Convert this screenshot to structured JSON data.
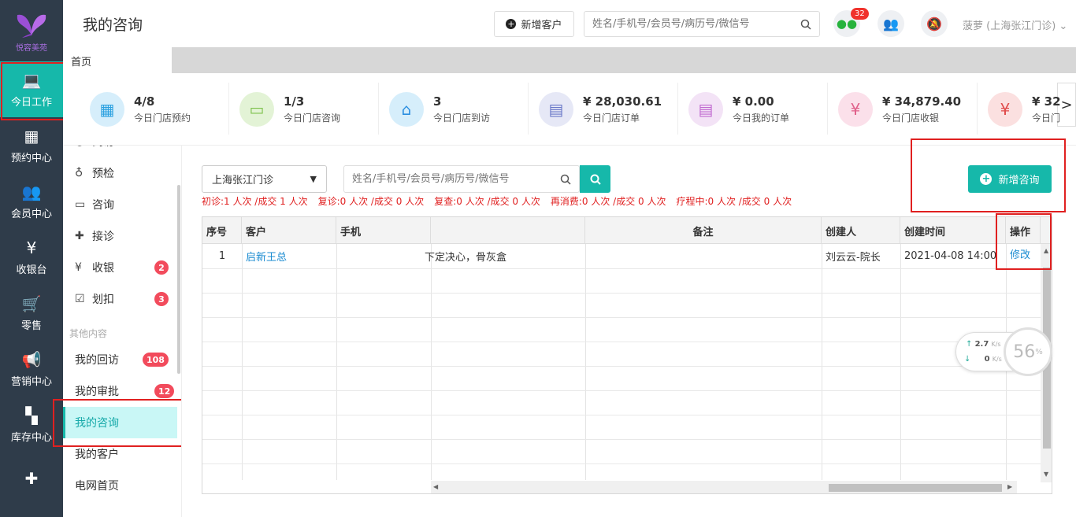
{
  "app": {
    "logo_text": "悦容美苑"
  },
  "nav": [
    {
      "label": "今日工作",
      "icon": "laptop-icon",
      "active": true
    },
    {
      "label": "预约中心",
      "icon": "calendar-icon"
    },
    {
      "label": "会员中心",
      "icon": "users-icon"
    },
    {
      "label": "收银台",
      "icon": "yuan-icon"
    },
    {
      "label": "零售",
      "icon": "cart-icon"
    },
    {
      "label": "营销中心",
      "icon": "megaphone-icon"
    },
    {
      "label": "库存中心",
      "icon": "grid-icon"
    },
    {
      "label": "",
      "icon": "medkit-icon"
    }
  ],
  "header": {
    "title": "我的咨询",
    "add_customer": "新增客户",
    "search_placeholder": "姓名/手机号/会员号/病历号/微信号",
    "chat_badge": "32",
    "user": "菠萝 (上海张江门诊) ⌄"
  },
  "tabs": [
    {
      "label": "首页"
    }
  ],
  "stats": [
    {
      "value": "4/8",
      "label": "今日门店预约",
      "icon": "calendar-check-icon",
      "bg": "#d6eefb",
      "fg": "#2aa0e0"
    },
    {
      "value": "1/3",
      "label": "今日门店咨询",
      "icon": "chat-icon",
      "bg": "#e3f3d6",
      "fg": "#7cc04a"
    },
    {
      "value": "3",
      "label": "今日门店到访",
      "icon": "store-icon",
      "bg": "#d6eefb",
      "fg": "#2a8ee0"
    },
    {
      "value": "¥ 28,030.61",
      "label": "今日门店订单",
      "icon": "newspaper-icon",
      "bg": "#e6e8f6",
      "fg": "#6a78c8"
    },
    {
      "value": "¥ 0.00",
      "label": "今日我的订单",
      "icon": "order-icon",
      "bg": "#f3e3f6",
      "fg": "#c06ad0"
    },
    {
      "value": "¥ 34,879.40",
      "label": "今日门店收银",
      "icon": "moneybag-icon",
      "bg": "#fbe0ea",
      "fg": "#e0608a"
    },
    {
      "value": "¥ 32",
      "label": "今日门",
      "icon": "receipt-icon",
      "bg": "#fbe0e0",
      "fg": "#e04a4a"
    }
  ],
  "submenu": {
    "items": [
      {
        "label": "到访",
        "icon": "walk-icon",
        "badge": ""
      },
      {
        "label": "预检",
        "icon": "stethoscope-icon",
        "badge": ""
      },
      {
        "label": "咨询",
        "icon": "chat-icon",
        "badge": ""
      },
      {
        "label": "接诊",
        "icon": "medkit-icon",
        "badge": ""
      },
      {
        "label": "收银",
        "icon": "yuan-icon",
        "badge": "2"
      },
      {
        "label": "划扣",
        "icon": "check-square-icon",
        "badge": "3"
      }
    ],
    "group_label": "其他内容",
    "other": [
      {
        "label": "我的回访",
        "badge": "108"
      },
      {
        "label": "我的审批",
        "badge": "12"
      },
      {
        "label": "我的咨询",
        "badge": "",
        "active": true
      },
      {
        "label": "我的客户",
        "badge": ""
      },
      {
        "label": "电网首页",
        "badge": ""
      }
    ]
  },
  "filter": {
    "store": "上海张江门诊",
    "search_placeholder": "姓名/手机号/会员号/病历号/微信号",
    "add_consult": "新增咨询"
  },
  "summary": [
    "初诊:1 人次 /成交 1 人次",
    "复诊:0 人次 /成交 0 人次",
    "复查:0 人次 /成交 0 人次",
    "再消费:0 人次 /成交 0 人次",
    "疗程中:0 人次 /成交 0 人次"
  ],
  "table": {
    "headers": [
      "序号",
      "客户",
      "手机",
      "",
      "备注",
      "创建人",
      "创建时间",
      "操作"
    ],
    "rows": [
      {
        "no": "1",
        "customer": "启新王总",
        "phone": "",
        "content": "下定决心，骨灰盒",
        "remark": "",
        "creator": "刘云云-院长",
        "created": "2021-04-08 14:00",
        "action": "修改"
      }
    ]
  },
  "network_widget": {
    "up": "2.7",
    "up_unit": "K/s",
    "down": "0",
    "down_unit": "K/s",
    "percent": "56",
    "percent_unit": "%"
  }
}
